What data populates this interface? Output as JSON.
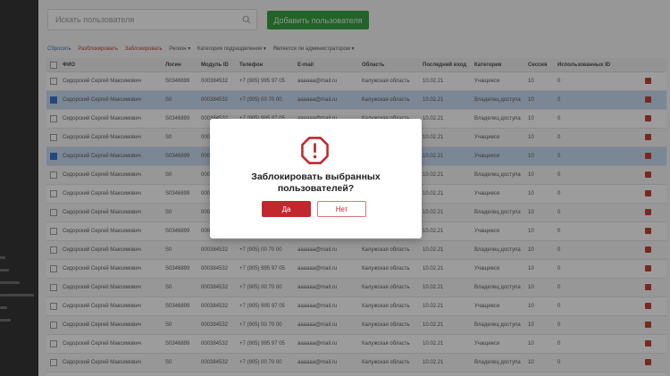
{
  "search": {
    "placeholder": "Искать пользователя"
  },
  "toolbar": {
    "add_label": "Добавить пользователя"
  },
  "filters": [
    {
      "label": "Сбросить",
      "accent": "blue"
    },
    {
      "label": "Разблокировать",
      "accent": "red"
    },
    {
      "label": "Заблокировать",
      "accent": "red"
    },
    {
      "label": "Регион ▾",
      "accent": "none"
    },
    {
      "label": "Категория подразделения ▾",
      "accent": "none"
    },
    {
      "label": "Является ли администратором ▾",
      "accent": "none"
    }
  ],
  "table": {
    "headers": [
      "",
      "ФИО",
      "Логин",
      "Модуль ID",
      "Телефон",
      "E-mail",
      "Область",
      "Последний вход",
      "Категория",
      "Сессия",
      "Использованных ID",
      ""
    ],
    "rows": [
      {
        "name": "Сидорский Сергей Максимович",
        "login": "S0346899",
        "module": "000384532",
        "phone": "+7 (905) 995 97 05",
        "email": "aaaaaa@mail.ru",
        "region": "Калужская область",
        "last": "10.02.21",
        "category": "Учащиеся",
        "session": "10",
        "used": "0",
        "selected": false
      },
      {
        "name": "Сидорский Сергей Максимович",
        "login": "S0",
        "module": "000384532",
        "phone": "+7 (905) 00 70 00",
        "email": "aaaaaa@mail.ru",
        "region": "Калужская область",
        "last": "10.02.21",
        "category": "Владелец доступа",
        "session": "10",
        "used": "0",
        "selected": true
      },
      {
        "name": "Сидорский Сергей Максимович",
        "login": "S0346899",
        "module": "000384532",
        "phone": "+7 (905) 995 97 05",
        "email": "aaaaaa@mail.ru",
        "region": "Калужская область",
        "last": "10.02.21",
        "category": "Владелец доступа",
        "session": "10",
        "used": "0",
        "selected": false
      },
      {
        "name": "Сидорский Сергей Максимович",
        "login": "S0",
        "module": "000384532",
        "phone": "+7 (905) 00 70 00",
        "email": "aaaaaa@mail.ru",
        "region": "Калужская область",
        "last": "10.02.21",
        "category": "Учащиеся",
        "session": "10",
        "used": "0",
        "selected": false
      },
      {
        "name": "Сидорский Сергей Максимович",
        "login": "S0346899",
        "module": "000384532",
        "phone": "+7 (905) 995 97 05",
        "email": "aaaaaa@mail.ru",
        "region": "Калужская область",
        "last": "10.02.21",
        "category": "Учащиеся",
        "session": "10",
        "used": "0",
        "selected": true
      },
      {
        "name": "Сидорский Сергей Максимович",
        "login": "S0",
        "module": "000384532",
        "phone": "+7 (905) 00 70 00",
        "email": "aaaaaa@mail.ru",
        "region": "Калужская область",
        "last": "10.02.21",
        "category": "Владелец доступа",
        "session": "10",
        "used": "0",
        "selected": false
      },
      {
        "name": "Сидорский Сергей Максимович",
        "login": "S0346899",
        "module": "000384532",
        "phone": "+7 (905) 995 97 05",
        "email": "aaaaaa@mail.ru",
        "region": "Калужская область",
        "last": "10.02.21",
        "category": "Учащиеся",
        "session": "10",
        "used": "0",
        "selected": false
      },
      {
        "name": "Сидорский Сергей Максимович",
        "login": "S0",
        "module": "000384532",
        "phone": "+7 (905) 00 70 00",
        "email": "aaaaaa@mail.ru",
        "region": "Калужская область",
        "last": "10.02.21",
        "category": "Владелец доступа",
        "session": "10",
        "used": "0",
        "selected": false
      },
      {
        "name": "Сидорский Сергей Максимович",
        "login": "S0346899",
        "module": "000384532",
        "phone": "+7 (905) 995 97 05",
        "email": "aaaaaa@mail.ru",
        "region": "Калужская область",
        "last": "10.02.21",
        "category": "Учащиеся",
        "session": "10",
        "used": "0",
        "selected": false
      },
      {
        "name": "Сидорский Сергей Максимович",
        "login": "S0",
        "module": "000384532",
        "phone": "+7 (905) 00 70 00",
        "email": "aaaaaa@mail.ru",
        "region": "Калужская область",
        "last": "10.02.21",
        "category": "Владелец доступа",
        "session": "10",
        "used": "0",
        "selected": false
      },
      {
        "name": "Сидорский Сергей Максимович",
        "login": "S0346899",
        "module": "000384532",
        "phone": "+7 (905) 995 97 05",
        "email": "aaaaaa@mail.ru",
        "region": "Калужская область",
        "last": "10.02.21",
        "category": "Учащиеся",
        "session": "10",
        "used": "0",
        "selected": false
      },
      {
        "name": "Сидорский Сергей Максимович",
        "login": "S0",
        "module": "000384532",
        "phone": "+7 (905) 00 70 00",
        "email": "aaaaaa@mail.ru",
        "region": "Калужская область",
        "last": "10.02.21",
        "category": "Владелец доступа",
        "session": "10",
        "used": "0",
        "selected": false
      },
      {
        "name": "Сидорский Сергей Максимович",
        "login": "S0346899",
        "module": "000384532",
        "phone": "+7 (905) 995 97 05",
        "email": "aaaaaa@mail.ru",
        "region": "Калужская область",
        "last": "10.02.21",
        "category": "Учащиеся",
        "session": "10",
        "used": "0",
        "selected": false
      },
      {
        "name": "Сидорский Сергей Максимович",
        "login": "S0",
        "module": "000384532",
        "phone": "+7 (905) 00 70 00",
        "email": "aaaaaa@mail.ru",
        "region": "Калужская область",
        "last": "10.02.21",
        "category": "Владелец доступа",
        "session": "10",
        "used": "0",
        "selected": false
      },
      {
        "name": "Сидорский Сергей Максимович",
        "login": "S0346899",
        "module": "000384532",
        "phone": "+7 (905) 995 97 05",
        "email": "aaaaaa@mail.ru",
        "region": "Калужская область",
        "last": "10.02.21",
        "category": "Учащиеся",
        "session": "10",
        "used": "0",
        "selected": false
      },
      {
        "name": "Сидорский Сергей Максимович",
        "login": "S0",
        "module": "000384532",
        "phone": "+7 (905) 00 70 00",
        "email": "aaaaaa@mail.ru",
        "region": "Калужская область",
        "last": "10.02.21",
        "category": "Владелец доступа",
        "session": "10",
        "used": "0",
        "selected": false
      },
      {
        "name": "Сидорский Сергей Максимович",
        "login": "S0346899",
        "module": "000384532",
        "phone": "+7 (905) 995 97 05",
        "email": "aaaaaa@mail.ru",
        "region": "Калужская область",
        "last": "10.02.21",
        "category": "Учащиеся",
        "session": "10",
        "used": "0",
        "selected": false
      }
    ]
  },
  "modal": {
    "icon": "warning-octagon-icon",
    "message": "Заблокировать выбранных пользователей?",
    "yes_label": "Да",
    "no_label": "Нет"
  },
  "colors": {
    "accent_green": "#2f9e3a",
    "danger_red": "#c0282d",
    "selected_row": "#c9dbf3",
    "sidebar": "#2b2b2b"
  }
}
